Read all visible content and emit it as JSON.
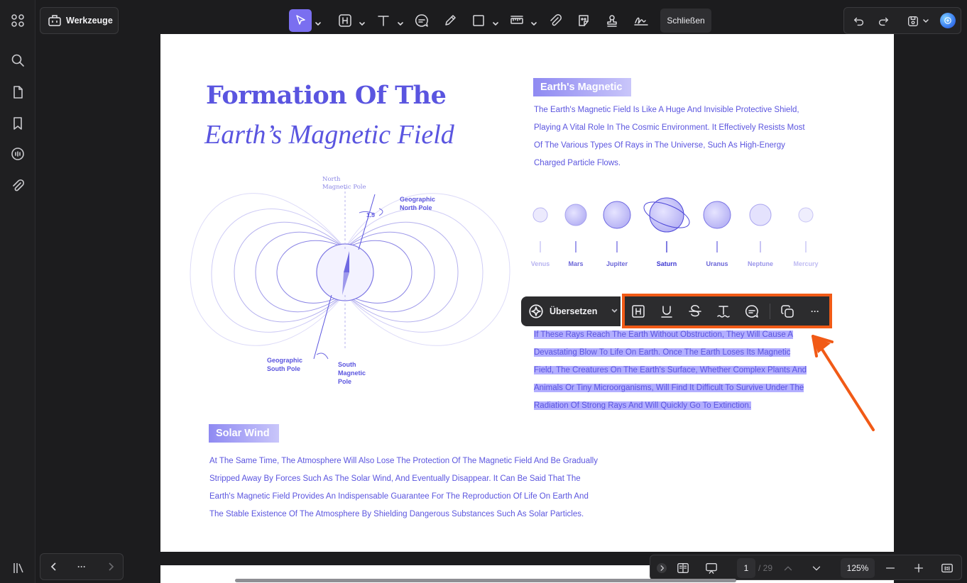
{
  "toolbar": {
    "tools_label": "Werkzeuge",
    "close_label": "Schließen"
  },
  "document": {
    "title_line1": "Formation Of The",
    "title_line2": "Earth’s Magnetic Field",
    "section1": {
      "tag": "Earth's Magnetic",
      "lines": [
        "The Earth's Magnetic Field Is Like A Huge And Invisible Protective Shield,",
        "Playing A Vital Role In The Cosmic Environment. It Effectively Resists Most",
        "Of The Various Types Of Rays in The Universe, Such As High-Energy",
        "Charged Particle Flows."
      ]
    },
    "planets": [
      "Venus",
      "Mars",
      "Jupiter",
      "Saturn",
      "Uranus",
      "Neptune",
      "Mercury"
    ],
    "diagram_labels": {
      "north_magnetic_pole": [
        "North",
        "Magnetic Pole"
      ],
      "geographic_north_pole": [
        "Geographic",
        "North Pole"
      ],
      "angle": "1.5",
      "geographic_south_pole": [
        "Geographic",
        "South Pole"
      ],
      "south_magnetic_pole": [
        "South",
        "Magnetic",
        "Pole"
      ]
    },
    "highlighted": {
      "lines": [
        "If These Rays Reach The Earth Without Obstruction, They Will Cause A",
        "Devastating Blow To Life On Earth. Once The Earth Loses Its Magnetic",
        "Field, The Creatures On The Earth's Surface, Whether Complex Plants And",
        "Animals Or Tiny Microorganisms, Will Find It Difficult To Survive Under The",
        "Radiation Of Strong Rays And Will Quickly Go To Extinction."
      ]
    },
    "section2": {
      "tag": "Solar Wind",
      "lines": [
        "At The Same Time, The Atmosphere Will Also Lose The Protection Of The Magnetic Field And Be Gradually",
        "Stripped Away By Forces Such As The Solar Wind, And Eventually Disappear. It Can Be Said That The",
        "Earth's Magnetic Field Provides An Indispensable Guarantee For The Reproduction Of Life On Earth And",
        "The Stable Existence Of The Atmosphere By Shielding Dangerous Substances Such As Solar Particles."
      ]
    }
  },
  "floating_toolbar": {
    "translate_label": "Übersetzen",
    "more_label": "···"
  },
  "bottom": {
    "nav_more": "···",
    "page_current": "1",
    "page_total": "/ 29",
    "zoom": "125%"
  },
  "colors": {
    "accent": "#7a6ff0",
    "doc_text": "#5b55df",
    "highlight": "#b3afff",
    "callout": "#f15a16"
  }
}
